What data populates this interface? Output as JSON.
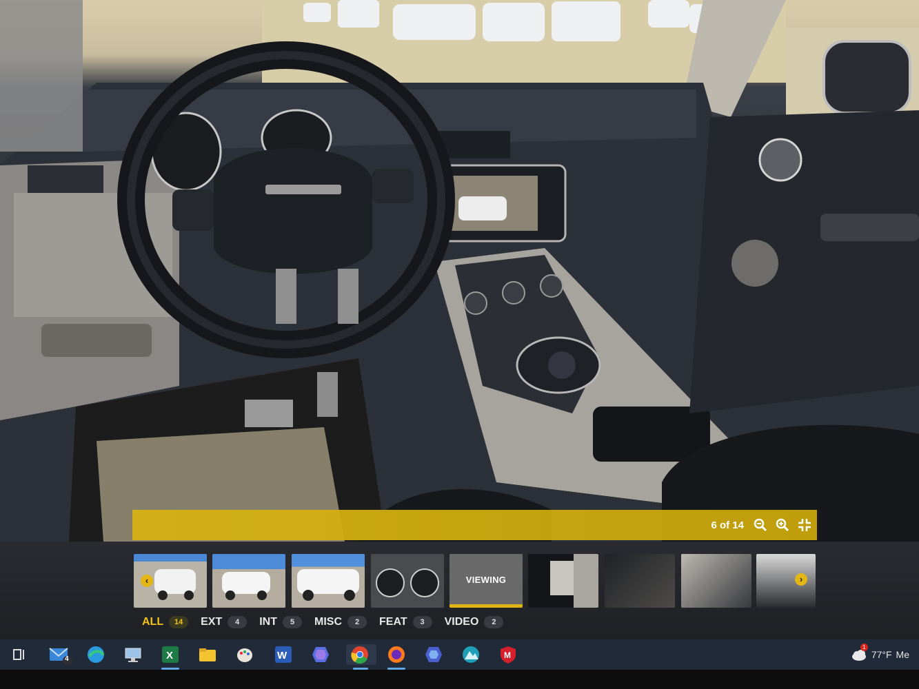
{
  "viewer": {
    "counter": "6 of 14",
    "controls": [
      "zoom-out-icon",
      "zoom-in-icon",
      "collapse-fullscreen-icon"
    ]
  },
  "thumbnails": [
    {
      "kind": "exterior"
    },
    {
      "kind": "exterior"
    },
    {
      "kind": "exterior"
    },
    {
      "kind": "gauges"
    },
    {
      "kind": "current",
      "label": "VIEWING"
    },
    {
      "kind": "interior"
    },
    {
      "kind": "interior"
    },
    {
      "kind": "interior"
    },
    {
      "kind": "cargo"
    }
  ],
  "categories": [
    {
      "label": "ALL",
      "count": "14",
      "active": true
    },
    {
      "label": "EXT",
      "count": "4"
    },
    {
      "label": "INT",
      "count": "5"
    },
    {
      "label": "MISC",
      "count": "2"
    },
    {
      "label": "FEAT",
      "count": "3"
    },
    {
      "label": "VIDEO",
      "count": "2"
    }
  ],
  "taskbar": {
    "mail_badge": "4",
    "notification_badge": "1",
    "weather": "77°F",
    "weather_suffix": "Me",
    "apps": [
      "task-view-icon",
      "mail-icon",
      "edge-icon",
      "remote-desktop-icon",
      "excel-icon",
      "file-explorer-icon",
      "paint-icon",
      "word-icon",
      "copilot-icon",
      "chrome-icon",
      "firefox-icon",
      "copilot-alt-icon",
      "photos-icon",
      "mcafee-icon"
    ]
  },
  "colors": {
    "accent": "#e3b614",
    "taskbar": "#202a38"
  }
}
